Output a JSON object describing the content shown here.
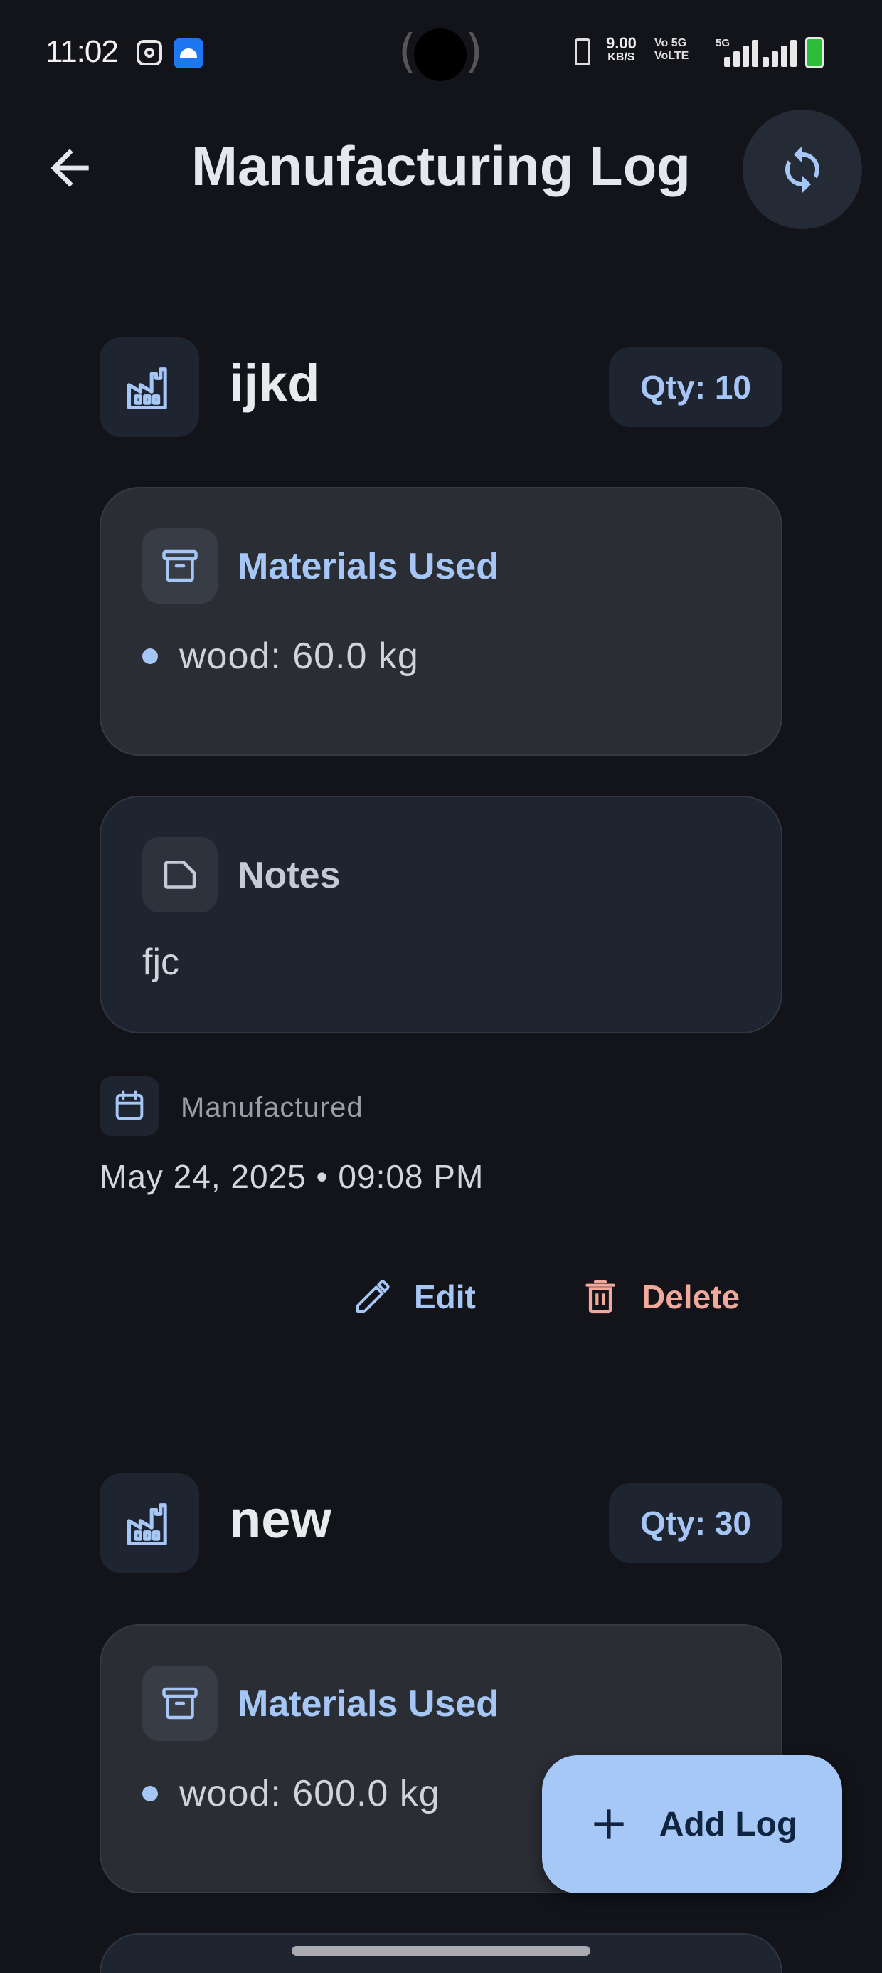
{
  "status_bar": {
    "time": "11:02",
    "net_speed": "9.00",
    "net_unit": "KB/S",
    "volte1": "Vo 5G",
    "volte2": "VoLTE",
    "network_type": "5G"
  },
  "app_bar": {
    "title": "Manufacturing Log",
    "back_icon": "arrow-back-icon",
    "refresh_icon": "refresh-icon"
  },
  "logs": [
    {
      "name": "ijkd",
      "qty": "Qty: 10",
      "materials_title": "Materials Used",
      "materials": [
        "wood: 60.0 kg"
      ],
      "notes_title": "Notes",
      "notes": "fjc",
      "manufactured_label": "Manufactured",
      "date": "May 24, 2025 • 09:08 PM",
      "edit_label": "Edit",
      "delete_label": "Delete"
    },
    {
      "name": "new",
      "qty": "Qty: 30",
      "materials_title": "Materials Used",
      "materials": [
        "wood: 600.0 kg"
      ]
    }
  ],
  "fab": {
    "label": "Add Log",
    "icon": "plus-icon"
  },
  "colors": {
    "background": "#12141a",
    "accent": "#a6c7f5",
    "danger": "#f2a99c",
    "fab": "#a6c8f7"
  }
}
